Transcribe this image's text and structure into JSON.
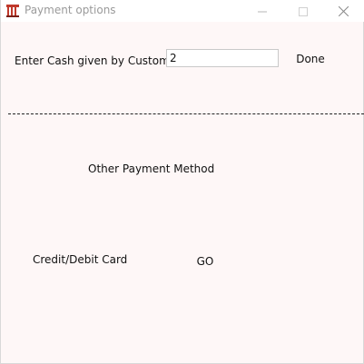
{
  "window": {
    "title": "Payment options",
    "icon": "payment-app-icon"
  },
  "titlebar_buttons": {
    "minimize": "minimize-icon",
    "maximize": "maximize-icon",
    "close": "close-icon"
  },
  "cash": {
    "label": "Enter Cash given by Customer :",
    "value": "2",
    "done_label": "Done"
  },
  "other_payment": {
    "label": "Other Payment Method"
  },
  "card": {
    "label": "Credit/Debit Card",
    "go_label": "GO"
  },
  "colors": {
    "window_bg": "#fef7f7",
    "titlebar_bg": "#ffffff",
    "title_text": "#9a9a9a",
    "app_icon_red": "#c0392b"
  }
}
